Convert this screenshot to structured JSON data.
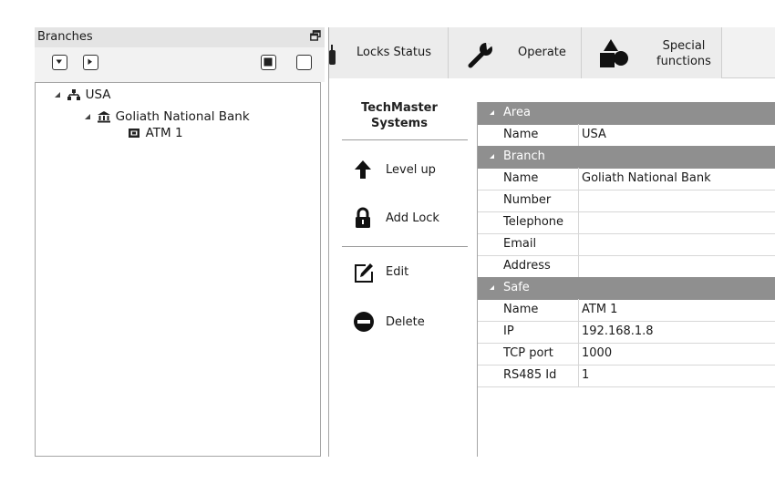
{
  "branches_panel": {
    "title": "Branches",
    "tree": [
      {
        "label": "USA",
        "icon": "network-icon",
        "level": 0
      },
      {
        "label": "Goliath National Bank",
        "icon": "bank-icon",
        "level": 1
      },
      {
        "label": "ATM 1",
        "icon": "safe-icon",
        "level": 2
      }
    ]
  },
  "tabs": [
    {
      "label": "Locks Status",
      "icon": "lock-icon"
    },
    {
      "label": "Operate",
      "icon": "wrench-icon"
    },
    {
      "label_line1": "Special",
      "label_line2": "functions",
      "icon": "shapes-icon"
    }
  ],
  "brand": {
    "line1": "TechMaster",
    "line2": "Systems"
  },
  "actions": {
    "level_up": "Level up",
    "add_lock": "Add Lock",
    "edit": "Edit",
    "delete": "Delete"
  },
  "properties": {
    "area": {
      "title": "Area",
      "rows": [
        {
          "key": "Name",
          "value": "USA"
        }
      ]
    },
    "branch": {
      "title": "Branch",
      "rows": [
        {
          "key": "Name",
          "value": "Goliath National Bank"
        },
        {
          "key": "Number",
          "value": ""
        },
        {
          "key": "Telephone",
          "value": ""
        },
        {
          "key": "Email",
          "value": ""
        },
        {
          "key": "Address",
          "value": ""
        }
      ]
    },
    "safe": {
      "title": "Safe",
      "rows": [
        {
          "key": "Name",
          "value": "ATM 1"
        },
        {
          "key": "IP",
          "value": "192.168.1.8"
        },
        {
          "key": "TCP port",
          "value": "1000"
        },
        {
          "key": "RS485 Id",
          "value": "1"
        }
      ]
    }
  },
  "colors": {
    "section_header": "#8f8f8f",
    "panel_header": "#e4e4e4"
  }
}
